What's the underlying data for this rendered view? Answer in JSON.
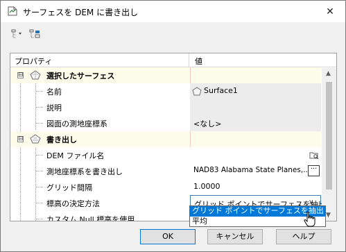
{
  "window": {
    "title": "サーフェスを DEM に書き出し",
    "close_glyph": "✕"
  },
  "toolbar": {
    "icons": [
      "category-view-icon",
      "alphabetic-view-icon"
    ]
  },
  "grid": {
    "header": {
      "property": "プロパティ",
      "value": "値"
    },
    "categories": [
      {
        "label": "選択したサーフェス",
        "expander": "⊟",
        "items": [
          {
            "label": "名前",
            "value": "Surface1"
          },
          {
            "label": "説明",
            "value": ""
          },
          {
            "label": "図面の測地座標系",
            "value": "<なし>"
          }
        ]
      },
      {
        "label": "書き出し",
        "expander": "⊟",
        "items": [
          {
            "label": "DEM ファイル名",
            "value": ""
          },
          {
            "label": "測地座標系を書き出し",
            "value": "NAD83 Alabama State Planes,...",
            "button": "···"
          },
          {
            "label": "グリッド間隔",
            "value": "1.0000"
          },
          {
            "label": "標高の決定方法",
            "value": "グリッド ポイントでサーフェスを抽出"
          },
          {
            "label": "カスタム Null 標高を使用",
            "value": ""
          }
        ]
      }
    ]
  },
  "dropdown": {
    "options": [
      "グリッド ポイントでサーフェスを抽出",
      "平均"
    ],
    "selected_index": 0
  },
  "buttons": {
    "ok": "OK",
    "cancel": "キャンセル",
    "help": "ヘルプ"
  },
  "colors": {
    "accent": "#0078d7",
    "category_bg": "#fdfbea",
    "readonly_bg": "#ececec"
  }
}
